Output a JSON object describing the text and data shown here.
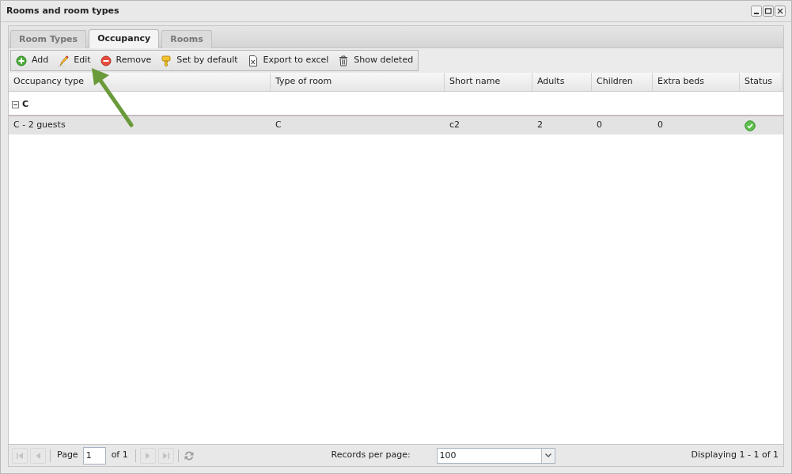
{
  "window": {
    "title": "Rooms and room types"
  },
  "tabs": [
    {
      "label": "Room Types",
      "selected": false
    },
    {
      "label": "Occupancy",
      "selected": true
    },
    {
      "label": "Rooms",
      "selected": false
    }
  ],
  "toolbar": [
    {
      "kind": "add",
      "label": "Add"
    },
    {
      "kind": "edit",
      "label": "Edit"
    },
    {
      "kind": "remove",
      "label": "Remove"
    },
    {
      "kind": "default",
      "label": "Set by default"
    },
    {
      "kind": "excel",
      "label": "Export to excel"
    },
    {
      "kind": "deleted",
      "label": "Show deleted"
    }
  ],
  "table": {
    "columns": [
      "Occupancy type",
      "Type of room",
      "Short name",
      "Adults",
      "Children",
      "Extra beds",
      "Status"
    ],
    "groups": [
      {
        "label": "C",
        "expanded": true,
        "rows": [
          {
            "cells": [
              "C - 2 guests",
              "C",
              "c2",
              "2",
              "0",
              "0"
            ],
            "active": true,
            "selected": true
          }
        ]
      }
    ]
  },
  "pager": {
    "page_label": "Page",
    "page": "1",
    "of_label": "of 1",
    "first_disabled": true,
    "prev_disabled": true,
    "next_disabled": true,
    "last_disabled": true,
    "records_label": "Records per page:",
    "records_value": "100",
    "display": "Displaying 1 - 1 of 1"
  }
}
